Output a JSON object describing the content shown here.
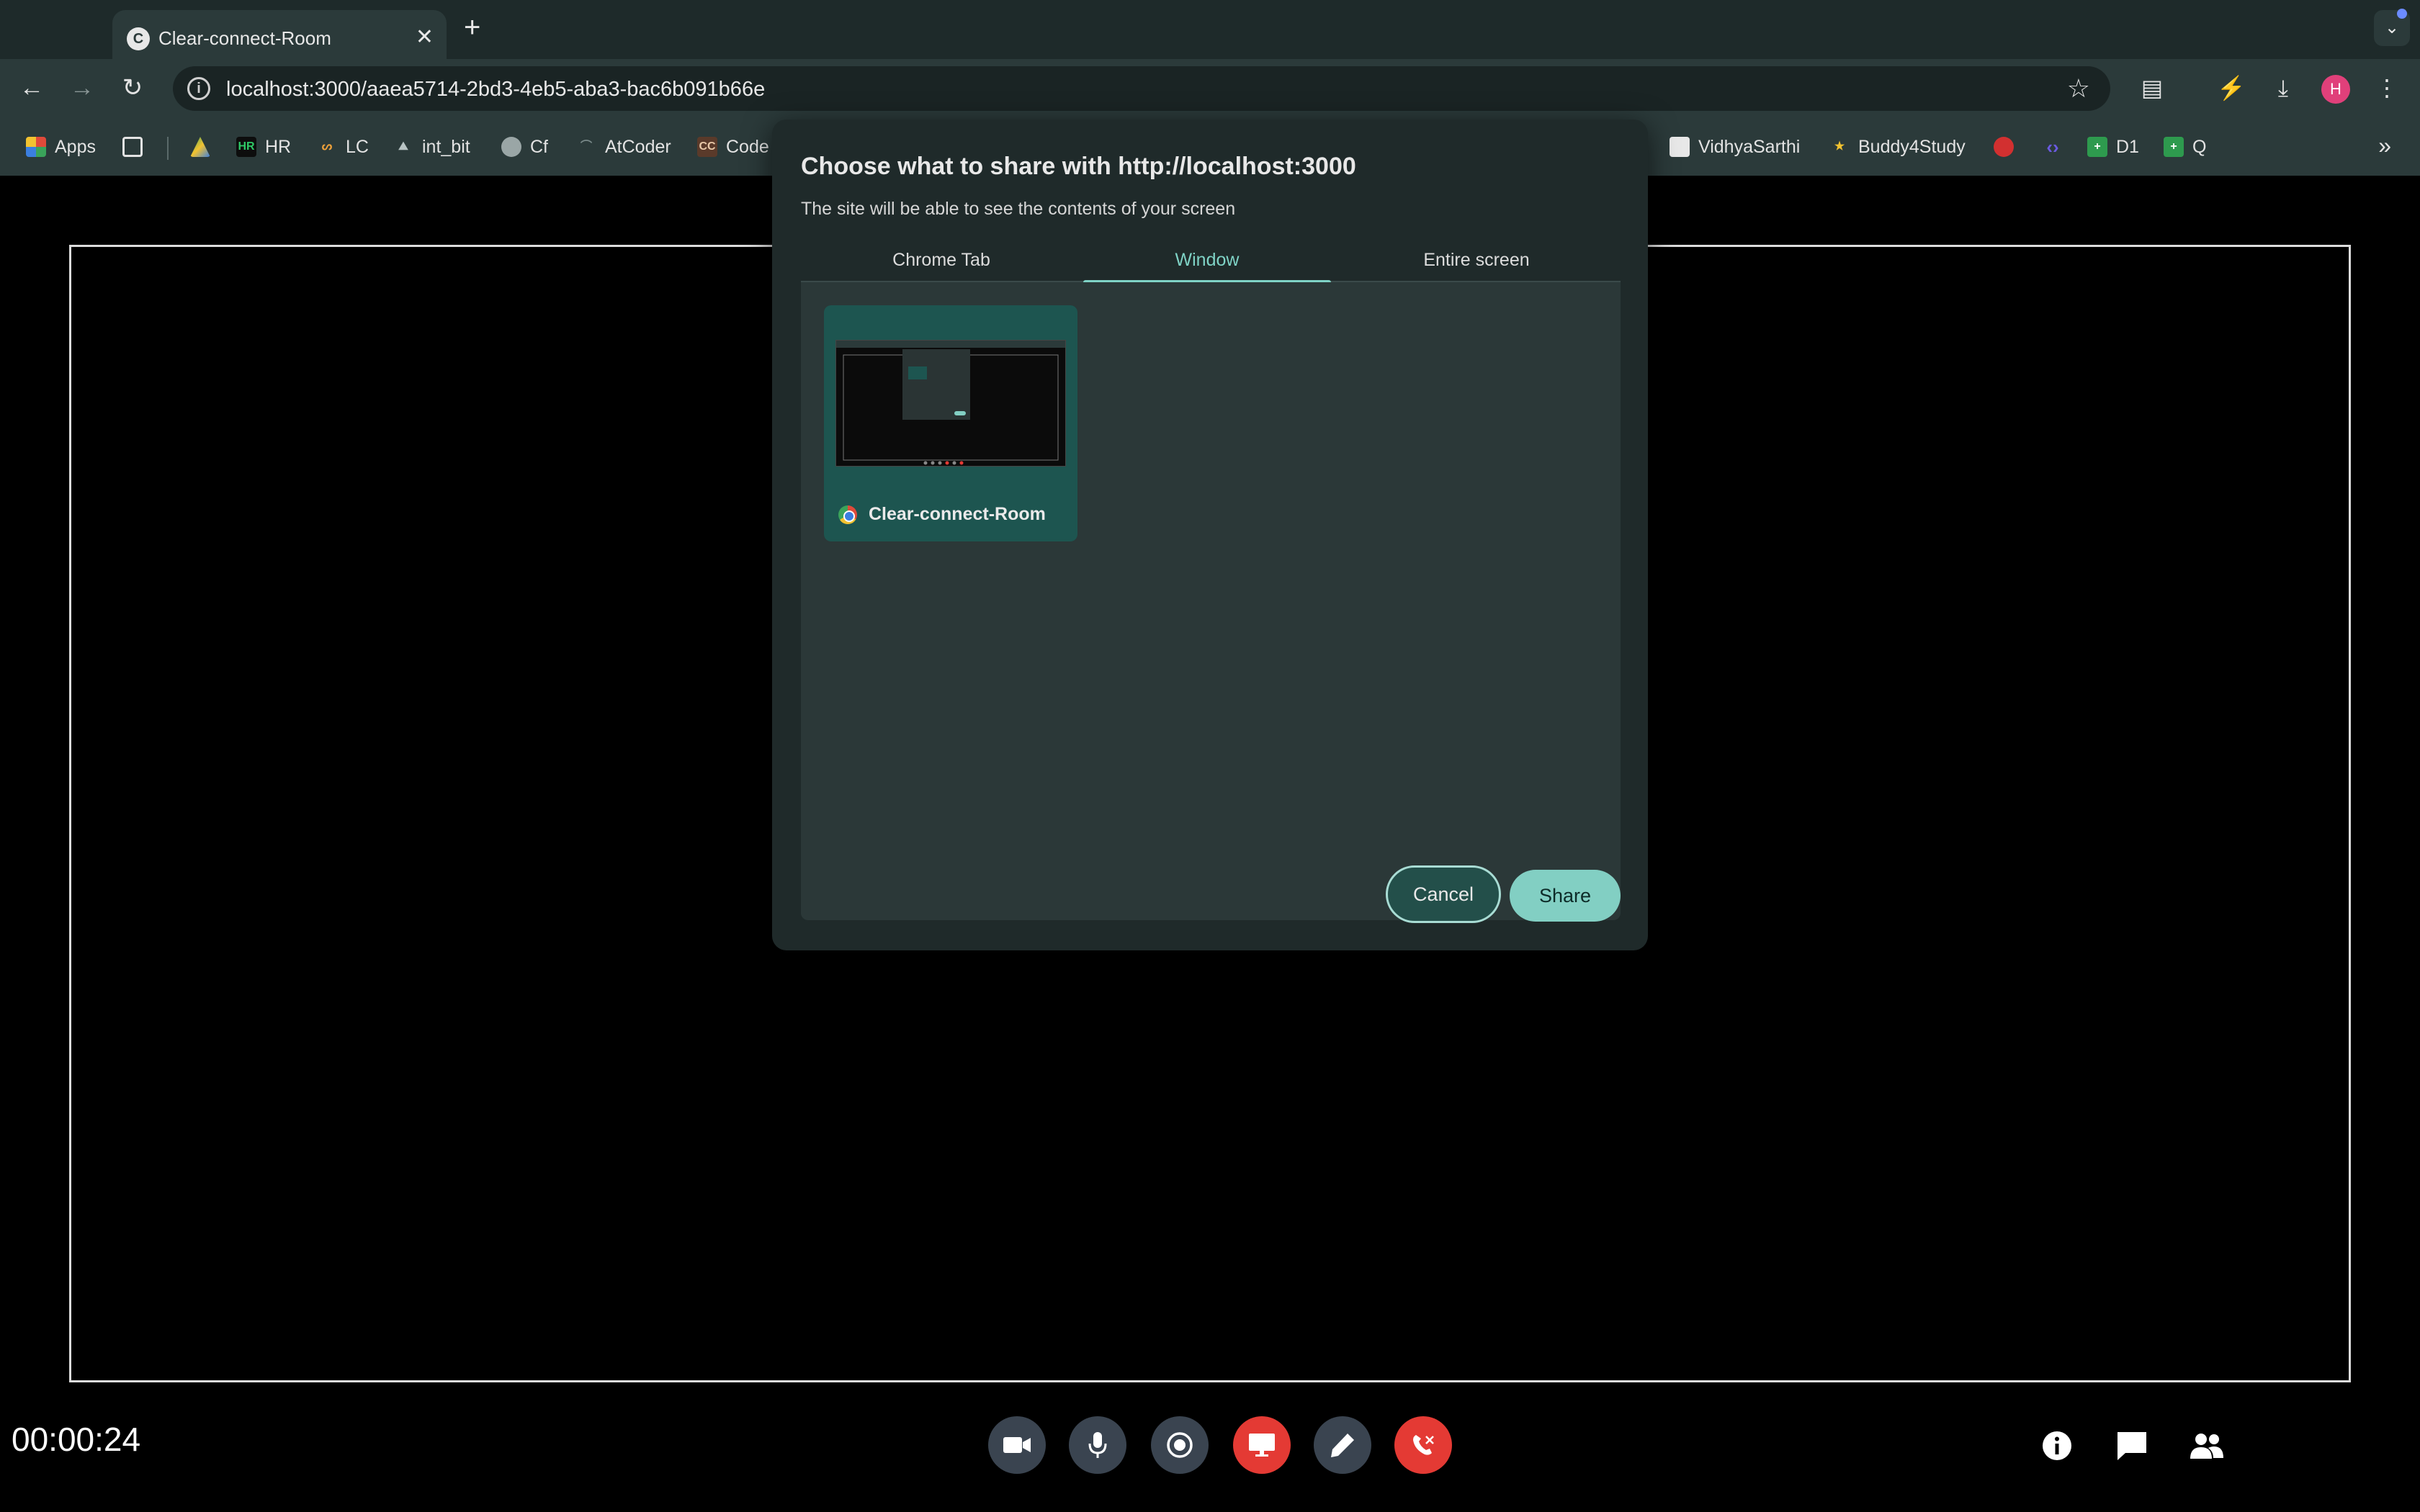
{
  "browser": {
    "tab_title": "Clear-connect-Room",
    "tab_favicon": "C",
    "close_glyph": "✕",
    "newtab_glyph": "+",
    "tabsearch_glyph": "⌄",
    "url": "localhost:3000/aaea5714-2bd3-4eb5-aba3-bac6b091b66e",
    "profile_initial": "H",
    "bookmarks": [
      {
        "label": "Apps"
      },
      {
        "label": "HR",
        "badge": "HR"
      },
      {
        "label": "LC"
      },
      {
        "label": "int_bit"
      },
      {
        "label": "Cf"
      },
      {
        "label": "AtCoder"
      },
      {
        "label": "Code",
        "badge": "CC"
      },
      {
        "label": "VidhyaSarthi"
      },
      {
        "label": "Buddy4Study"
      },
      {
        "label": "D1"
      },
      {
        "label": "Q"
      }
    ]
  },
  "dialog": {
    "title": "Choose what to share with http://localhost:3000",
    "subtitle": "The site will be able to see the contents of your screen",
    "tabs": [
      "Chrome Tab",
      "Window",
      "Entire screen"
    ],
    "active_tab": "Window",
    "sources": [
      {
        "label": "Clear-connect-Room",
        "icon": "chrome-icon"
      }
    ],
    "cancel_label": "Cancel",
    "share_label": "Share"
  },
  "call": {
    "timer": "00:00:24",
    "controls": [
      "camera-icon",
      "microphone-icon",
      "record-icon",
      "screen-share-icon",
      "pen-icon",
      "end-call-icon"
    ],
    "right_controls": [
      "info-icon",
      "chat-icon",
      "participants-icon"
    ]
  },
  "colors": {
    "accent": "#7fd3c6",
    "danger": "#e43a34",
    "dialog_bg": "#1f2a2a",
    "chrome_bg": "#2b3a3a"
  }
}
